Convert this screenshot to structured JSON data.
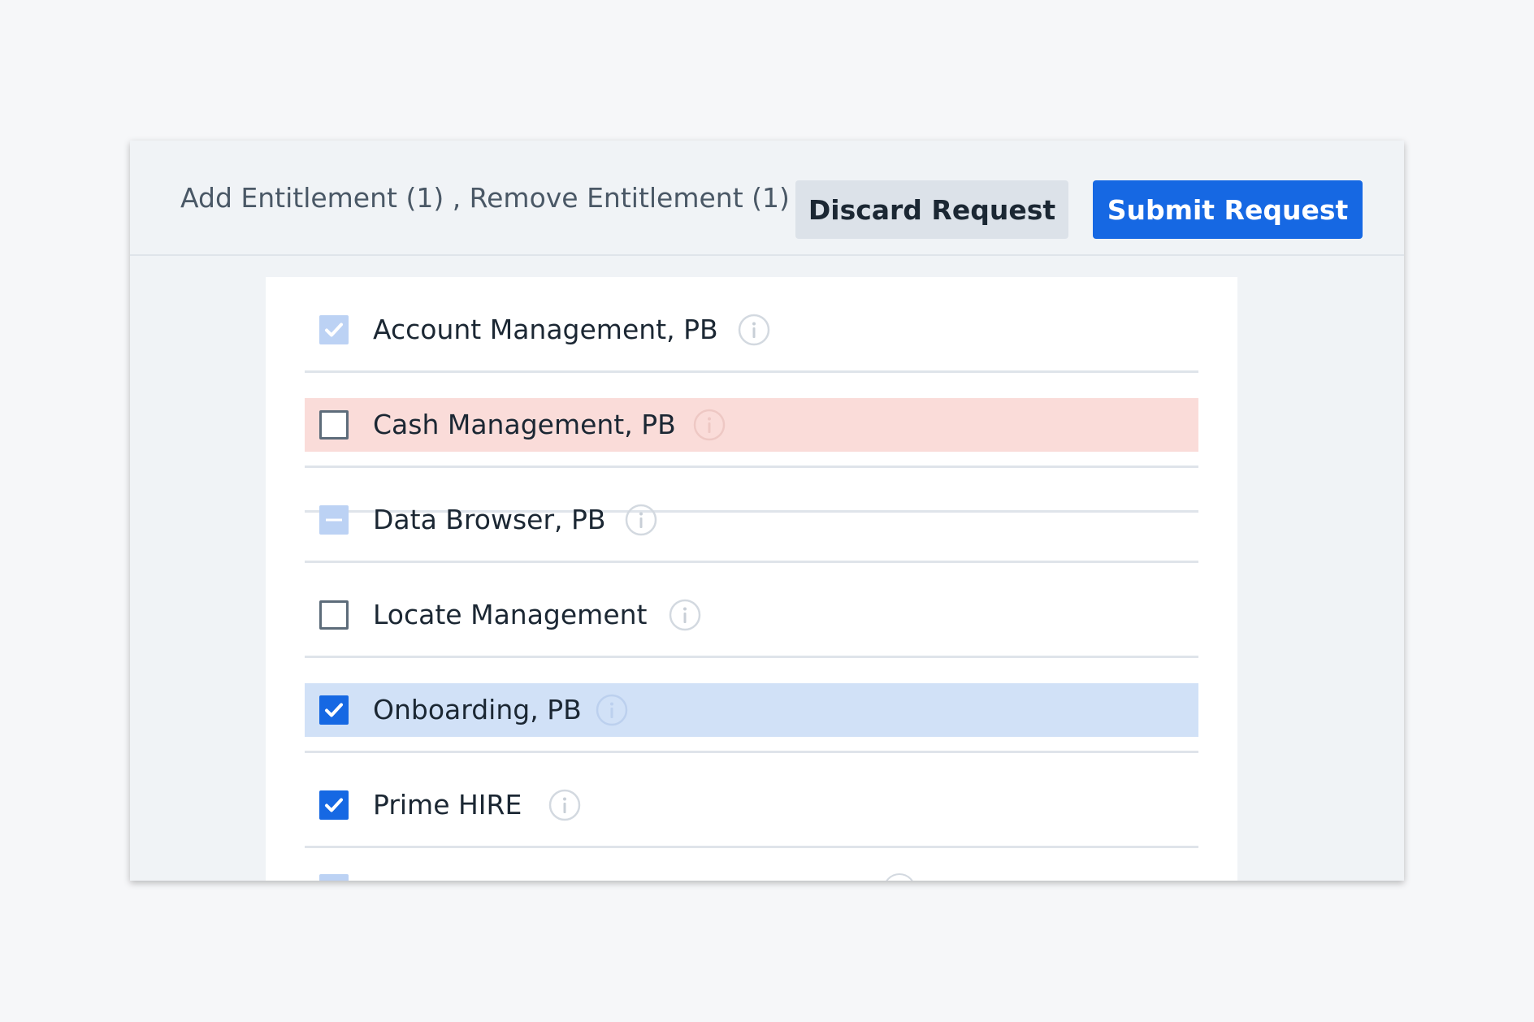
{
  "header": {
    "summary": "Add Entitlement (1) , Remove Entitlement (1)",
    "discard_label": "Discard Request",
    "submit_label": "Submit Request"
  },
  "entitlements": [
    {
      "label": "Account Management, PB",
      "state": "checked-disabled",
      "highlight": "none"
    },
    {
      "label": "Cash Management, PB",
      "state": "unchecked",
      "highlight": "remove"
    },
    {
      "label": "Data Browser, PB",
      "state": "indeterminate-disabled",
      "highlight": "none"
    },
    {
      "label": "Locate Management",
      "state": "unchecked",
      "highlight": "none"
    },
    {
      "label": "Onboarding, PB",
      "state": "checked",
      "highlight": "add"
    },
    {
      "label": "Prime HIRE",
      "state": "checked",
      "highlight": "none"
    }
  ],
  "colors": {
    "primary": "#1668e3",
    "add_highlight": "#d1e1f7",
    "remove_highlight": "#fadcd9"
  },
  "icons": {
    "info": "info-circle-icon",
    "check": "checkmark-icon",
    "dash": "minus-icon"
  }
}
